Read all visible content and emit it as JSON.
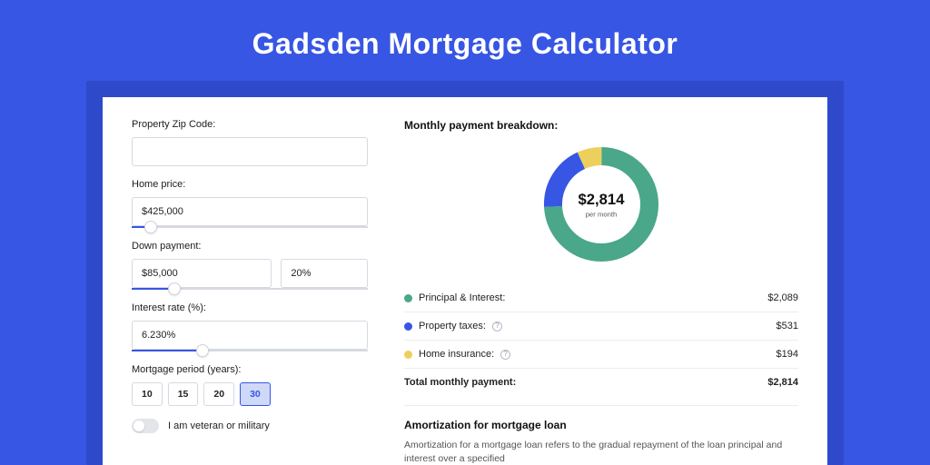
{
  "title": "Gadsden Mortgage Calculator",
  "form": {
    "zip": {
      "label": "Property Zip Code:",
      "value": ""
    },
    "home_price": {
      "label": "Home price:",
      "value": "$425,000",
      "slider_pct": 8
    },
    "down_payment": {
      "label": "Down payment:",
      "amount": "$85,000",
      "pct": "20%",
      "slider_pct": 18
    },
    "interest_rate": {
      "label": "Interest rate (%):",
      "value": "6.230%",
      "slider_pct": 30
    },
    "mortgage_period": {
      "label": "Mortgage period (years):",
      "options": [
        "10",
        "15",
        "20",
        "30"
      ],
      "active_index": 3
    },
    "veteran": {
      "label": "I am veteran or military",
      "on": false
    }
  },
  "breakdown": {
    "title": "Monthly payment breakdown:",
    "center_value": "$2,814",
    "center_sub": "per month",
    "items": [
      {
        "label": "Principal & Interest:",
        "value": "$2,089",
        "color": "#4aa789",
        "info": false,
        "pct": 74.2
      },
      {
        "label": "Property taxes:",
        "value": "$531",
        "color": "#3756e4",
        "info": true,
        "pct": 18.9
      },
      {
        "label": "Home insurance:",
        "value": "$194",
        "color": "#ecd05b",
        "info": true,
        "pct": 6.9
      }
    ],
    "total": {
      "label": "Total monthly payment:",
      "value": "$2,814"
    }
  },
  "amortization": {
    "title": "Amortization for mortgage loan",
    "text": "Amortization for a mortgage loan refers to the gradual repayment of the loan principal and interest over a specified"
  },
  "chart_data": {
    "type": "pie",
    "title": "Monthly payment breakdown",
    "categories": [
      "Principal & Interest",
      "Property taxes",
      "Home insurance"
    ],
    "values": [
      2089,
      531,
      194
    ],
    "colors": [
      "#4aa789",
      "#3756e4",
      "#ecd05b"
    ],
    "total": 2814,
    "center_label": "$2,814 per month"
  }
}
